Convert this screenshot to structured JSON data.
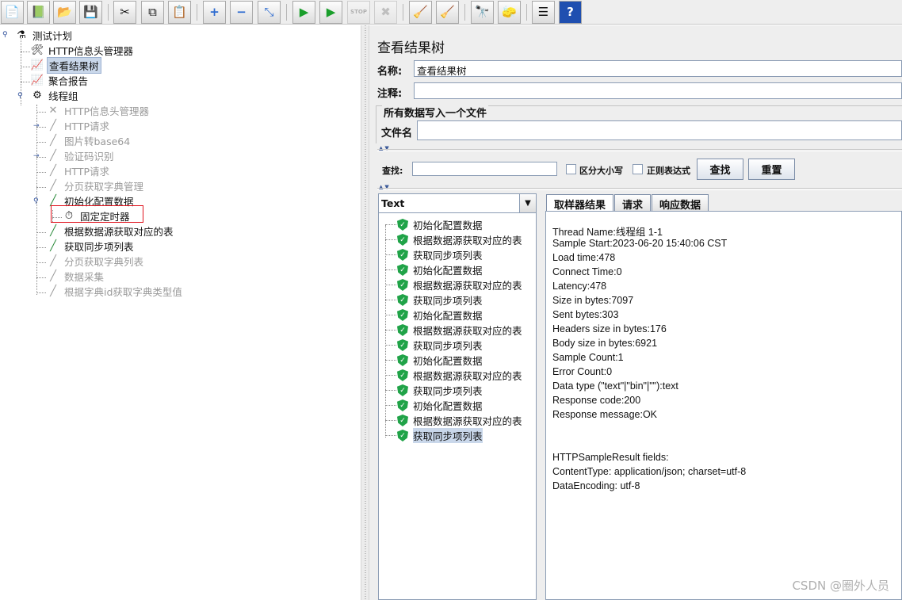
{
  "toolbar": {
    "icons": [
      "new-icon",
      "templates-icon",
      "open-icon",
      "save-icon",
      "cut-icon",
      "copy-icon",
      "paste-icon",
      "expand-icon",
      "collapse-icon",
      "toggle-icon",
      "start-icon",
      "start-no-pause-icon",
      "stop-icon",
      "shutdown-icon",
      "clear-icon",
      "clear-all-icon",
      "search-icon",
      "reset-search-icon",
      "function-helper-icon",
      "help-icon"
    ],
    "stop_text": "STOP"
  },
  "tree": {
    "root": "测试计划",
    "items": [
      {
        "label": "HTTP信息头管理器",
        "enabled": true
      },
      {
        "label": "查看结果树",
        "enabled": true,
        "selected": true
      },
      {
        "label": "聚合报告",
        "enabled": true
      },
      {
        "label": "线程组",
        "enabled": true
      }
    ],
    "children": [
      {
        "label": "HTTP信息头管理器",
        "enabled": false
      },
      {
        "label": "HTTP请求",
        "enabled": false
      },
      {
        "label": "图片转base64",
        "enabled": false
      },
      {
        "label": "验证码识别",
        "enabled": false
      },
      {
        "label": "HTTP请求",
        "enabled": false
      },
      {
        "label": "分页获取字典管理",
        "enabled": false
      },
      {
        "label": "初始化配置数据",
        "enabled": true
      },
      {
        "label": "固定定时器",
        "enabled": true
      },
      {
        "label": "根据数据源获取对应的表",
        "enabled": true
      },
      {
        "label": "获取同步项列表",
        "enabled": true
      },
      {
        "label": "分页获取字典列表",
        "enabled": false
      },
      {
        "label": "数据采集",
        "enabled": false
      },
      {
        "label": "根据字典id获取字典类型值",
        "enabled": false
      }
    ],
    "highlight_color": "#e0141e"
  },
  "panel": {
    "title": "查看结果树",
    "name_label": "名称:",
    "name_value": "查看结果树",
    "comment_label": "注释:",
    "comment_value": "",
    "file_group_title": "所有数据写入一个文件",
    "filename_label": "文件名",
    "filename_value": "",
    "search_label": "查找:",
    "search_value": "",
    "case_label": "区分大小写",
    "regex_label": "正则表达式",
    "find_button": "查找",
    "reset_button": "重置"
  },
  "results": {
    "renderer": "Text",
    "items": [
      "初始化配置数据",
      "根据数据源获取对应的表",
      "获取同步项列表",
      "初始化配置数据",
      "根据数据源获取对应的表",
      "获取同步项列表",
      "初始化配置数据",
      "根据数据源获取对应的表",
      "获取同步项列表",
      "初始化配置数据",
      "根据数据源获取对应的表",
      "获取同步项列表",
      "初始化配置数据",
      "根据数据源获取对应的表",
      "获取同步项列表"
    ],
    "selected_index": 14,
    "ok_color": "#20a348"
  },
  "detail": {
    "tabs": [
      "取样器结果",
      "请求",
      "响应数据"
    ],
    "active_tab": 0,
    "lines": [
      "Thread Name:线程组 1-1",
      "Sample Start:2023-06-20 15:40:06 CST",
      "Load time:478",
      "Connect Time:0",
      "Latency:478",
      "Size in bytes:7097",
      "Sent bytes:303",
      "Headers size in bytes:176",
      "Body size in bytes:6921",
      "Sample Count:1",
      "Error Count:0",
      "Data type (\"text\"|\"bin\"|\"\"):text",
      "Response code:200",
      "Response message:OK",
      "",
      "",
      "HTTPSampleResult fields:",
      "ContentType: application/json; charset=utf-8",
      "DataEncoding: utf-8"
    ]
  },
  "watermark": "CSDN @圈外人员"
}
